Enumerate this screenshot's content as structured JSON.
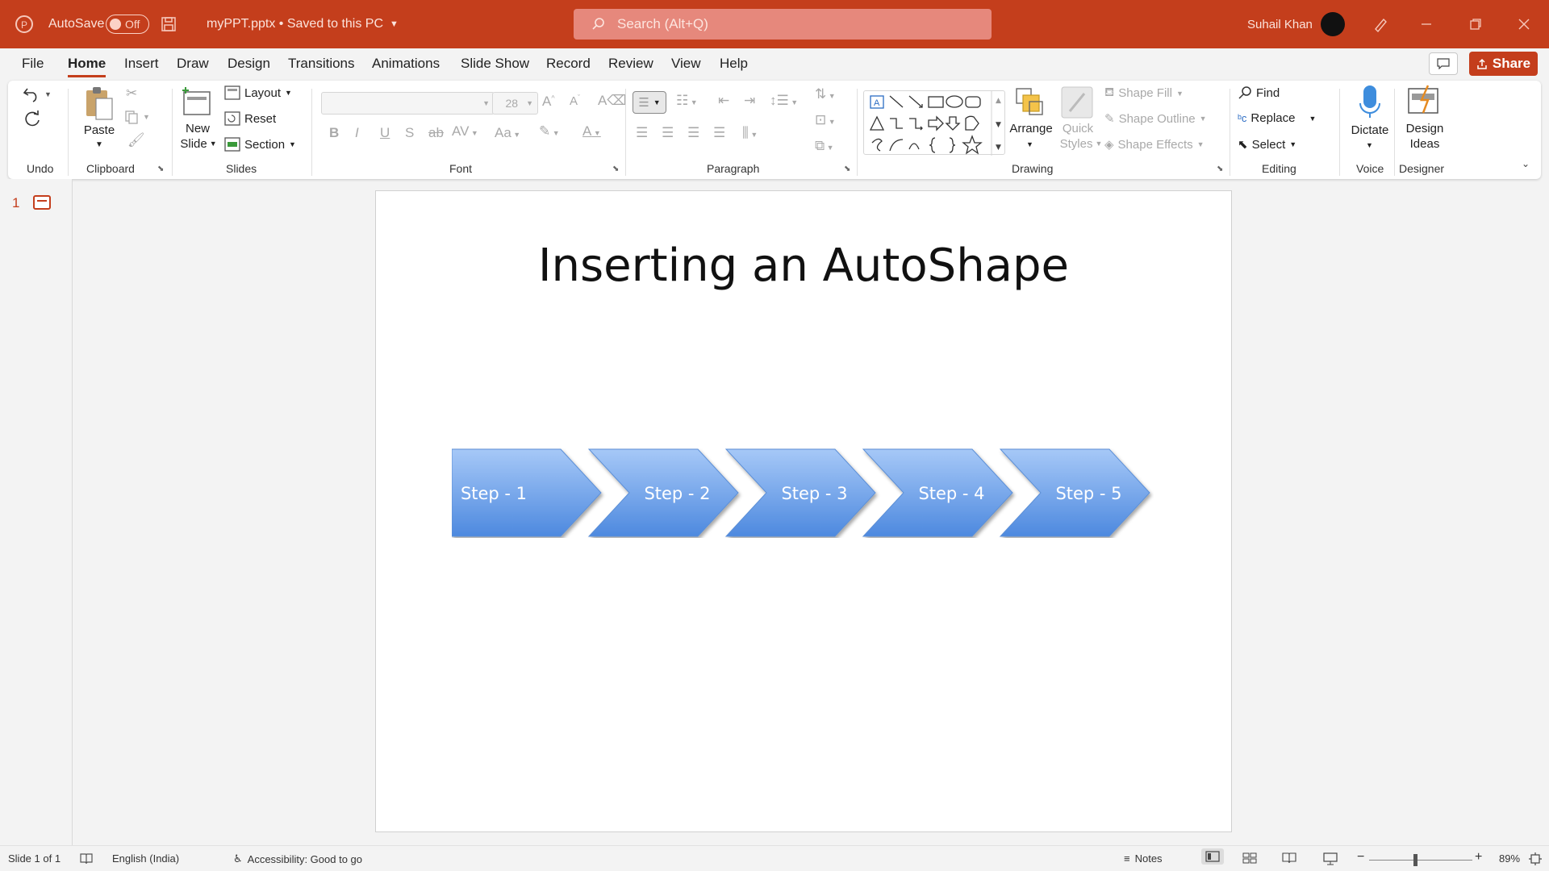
{
  "titlebar": {
    "autosave_label": "AutoSave",
    "autosave_state": "Off",
    "filename": "myPPT.pptx • Saved to this PC",
    "search_placeholder": "Search (Alt+Q)",
    "user_name": "Suhail Khan"
  },
  "tabs": [
    "File",
    "Home",
    "Insert",
    "Draw",
    "Design",
    "Transitions",
    "Animations",
    "Slide Show",
    "Record",
    "Review",
    "View",
    "Help"
  ],
  "active_tab": "Home",
  "share_label": "Share",
  "ribbon": {
    "groups": {
      "undo": "Undo",
      "clipboard": "Clipboard",
      "slides": "Slides",
      "font": "Font",
      "paragraph": "Paragraph",
      "drawing": "Drawing",
      "editing": "Editing",
      "voice": "Voice",
      "designer": "Designer"
    },
    "paste": "Paste",
    "new_slide_1": "New",
    "new_slide_2": "Slide",
    "layout": "Layout",
    "reset": "Reset",
    "section": "Section",
    "font_size": "28",
    "arrange": "Arrange",
    "quick_styles_1": "Quick",
    "quick_styles_2": "Styles",
    "shape_fill": "Shape Fill",
    "shape_outline": "Shape Outline",
    "shape_effects": "Shape Effects",
    "find": "Find",
    "replace": "Replace",
    "select": "Select",
    "dictate": "Dictate",
    "design_ideas_1": "Design",
    "design_ideas_2": "Ideas"
  },
  "slide_panel": {
    "slide_number": "1"
  },
  "slide": {
    "title": "Inserting an AutoShape",
    "steps": [
      "Step - 1",
      "Step - 2",
      "Step - 3",
      "Step - 4",
      "Step - 5"
    ]
  },
  "statusbar": {
    "slide_info": "Slide 1 of 1",
    "language": "English (India)",
    "accessibility": "Accessibility: Good to go",
    "notes": "Notes",
    "zoom": "89%"
  },
  "colors": {
    "accent": "#c43e1c",
    "shape_fill_top": "#9ec3f5",
    "shape_fill_bottom": "#4e8ce0"
  }
}
